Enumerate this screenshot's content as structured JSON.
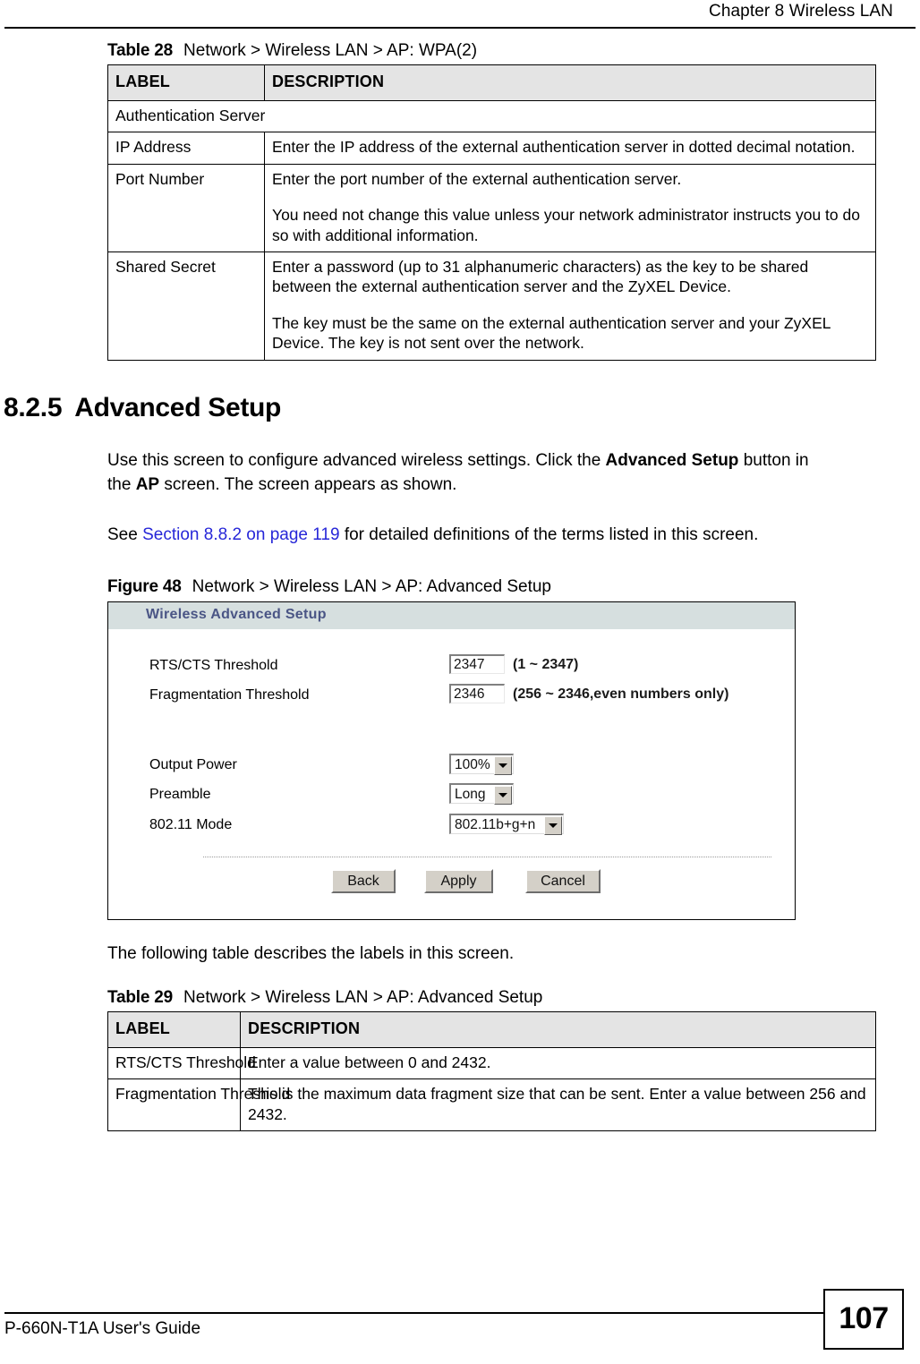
{
  "header": {
    "chapter_title": "Chapter 8 Wireless LAN"
  },
  "table28": {
    "caption_number": "Table 28",
    "caption_text": "Network > Wireless LAN > AP: WPA(2)",
    "columns": [
      "LABEL",
      "DESCRIPTION"
    ],
    "group_row": "Authentication Server",
    "rows": [
      {
        "label": "IP Address",
        "description": [
          "Enter the IP address of the external authentication server in dotted decimal notation."
        ]
      },
      {
        "label": "Port Number",
        "description": [
          "Enter the port number of the external authentication server.",
          "You need not change this value unless your network administrator instructs you to do so with additional information."
        ]
      },
      {
        "label": "Shared Secret",
        "description": [
          "Enter a password (up to 31 alphanumeric characters) as the key to be shared between the external authentication server and the ZyXEL Device.",
          "The key must be the same on the external authentication server and your ZyXEL Device. The key is not sent over the network."
        ]
      }
    ]
  },
  "section": {
    "number": "8.2.5",
    "title": "Advanced Setup",
    "para1_a": "Use this screen to configure advanced wireless settings. Click the ",
    "para1_b": "Advanced Setup",
    "para1_c": " button in the ",
    "para1_d": "AP",
    "para1_e": " screen. The screen appears as shown.",
    "para2_a": "See ",
    "para2_link": "Section 8.8.2 on page 119",
    "para2_b": " for detailed definitions of the terms listed in this screen."
  },
  "figure48": {
    "caption_number": "Figure 48",
    "caption_text": "Network > Wireless LAN > AP: Advanced Setup",
    "ui": {
      "panel_title": "Wireless Advanced Setup",
      "panel_title_color": "#4a5585",
      "panel_header_bg": "#d6dfdf",
      "fields": [
        {
          "label": "RTS/CTS  Threshold",
          "value": "2347",
          "hint": "(1 ~ 2347)"
        },
        {
          "label": "Fragmentation  Threshold",
          "value": "2346",
          "hint": "(256 ~ 2346,even numbers only)"
        }
      ],
      "selects": [
        {
          "label": "Output Power",
          "value": "100%"
        },
        {
          "label": "Preamble",
          "value": "Long"
        },
        {
          "label": "802.11 Mode",
          "value": "802.11b+g+n"
        }
      ],
      "buttons": [
        "Back",
        "Apply",
        "Cancel"
      ]
    }
  },
  "after_figure_para": "The following table describes the labels in this screen.",
  "table29": {
    "caption_number": "Table 29",
    "caption_text": "Network > Wireless LAN > AP: Advanced Setup",
    "columns": [
      "LABEL",
      "DESCRIPTION"
    ],
    "rows": [
      {
        "label": "RTS/CTS Threshold",
        "description": [
          "Enter a value between 0 and 2432."
        ]
      },
      {
        "label": "Fragmentation Threshold",
        "description": [
          "This is the maximum data fragment size that can be sent. Enter a value between 256 and 2432."
        ]
      }
    ]
  },
  "footer": {
    "guide_name": "P-660N-T1A User's Guide",
    "page_number": "107"
  }
}
